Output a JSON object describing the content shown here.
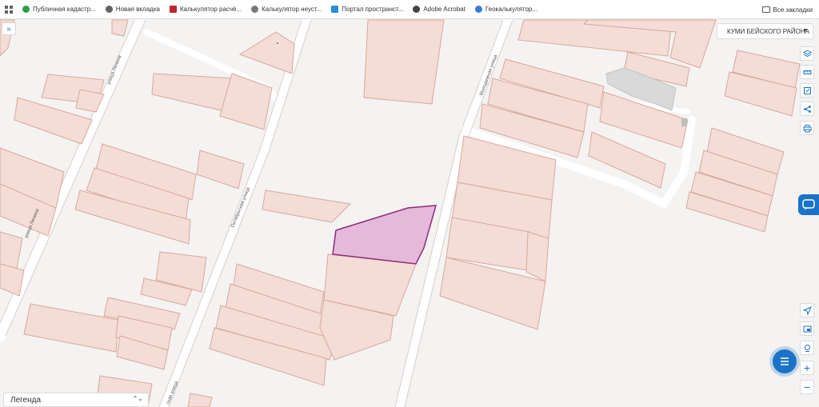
{
  "bookmarks": {
    "items": [
      {
        "label": "Публичная кадастр...",
        "color": "#2e9d47"
      },
      {
        "label": "Новая вкладка",
        "color": "#5f6368"
      },
      {
        "label": "Калькулятор расчё...",
        "color": "#c0262d"
      },
      {
        "label": "Калькулятор неуст...",
        "color": "#777777"
      },
      {
        "label": "Портал пространст...",
        "color": "#2b8fd6"
      },
      {
        "label": "Adobe Acrobat",
        "color": "#444444"
      },
      {
        "label": "Геокалькулятор...",
        "color": "#3a7bd5"
      }
    ],
    "all_label": "Все закладки"
  },
  "map": {
    "region_select": "КУМИ БЕЙСКОГО РАЙОНА",
    "streets": {
      "lenina": "улица Ленина",
      "lenina_2": "улица Ленина",
      "oktyabrskaya": "Октябрьская улица",
      "molodezhnaya": "Молодежная улица",
      "bottom": "ская улица"
    },
    "colors": {
      "parcel_fill": "#f3ddd6",
      "parcel_stroke": "#d9a79b",
      "selected_fill": "#e4b9da",
      "selected_stroke": "#8e2b7a",
      "road": "#ffffff",
      "accent": "#1a73c7"
    },
    "tools_top": [
      "layers-icon",
      "ruler-icon",
      "edit-icon",
      "share-icon",
      "print-icon"
    ],
    "tools_bottom": [
      "locate-icon",
      "image-icon",
      "pin-icon",
      "zoom-in-icon",
      "zoom-out-icon"
    ],
    "zoom_in": "+",
    "zoom_out": "−",
    "collapse": "»"
  },
  "legend": {
    "label": "Легенда"
  }
}
